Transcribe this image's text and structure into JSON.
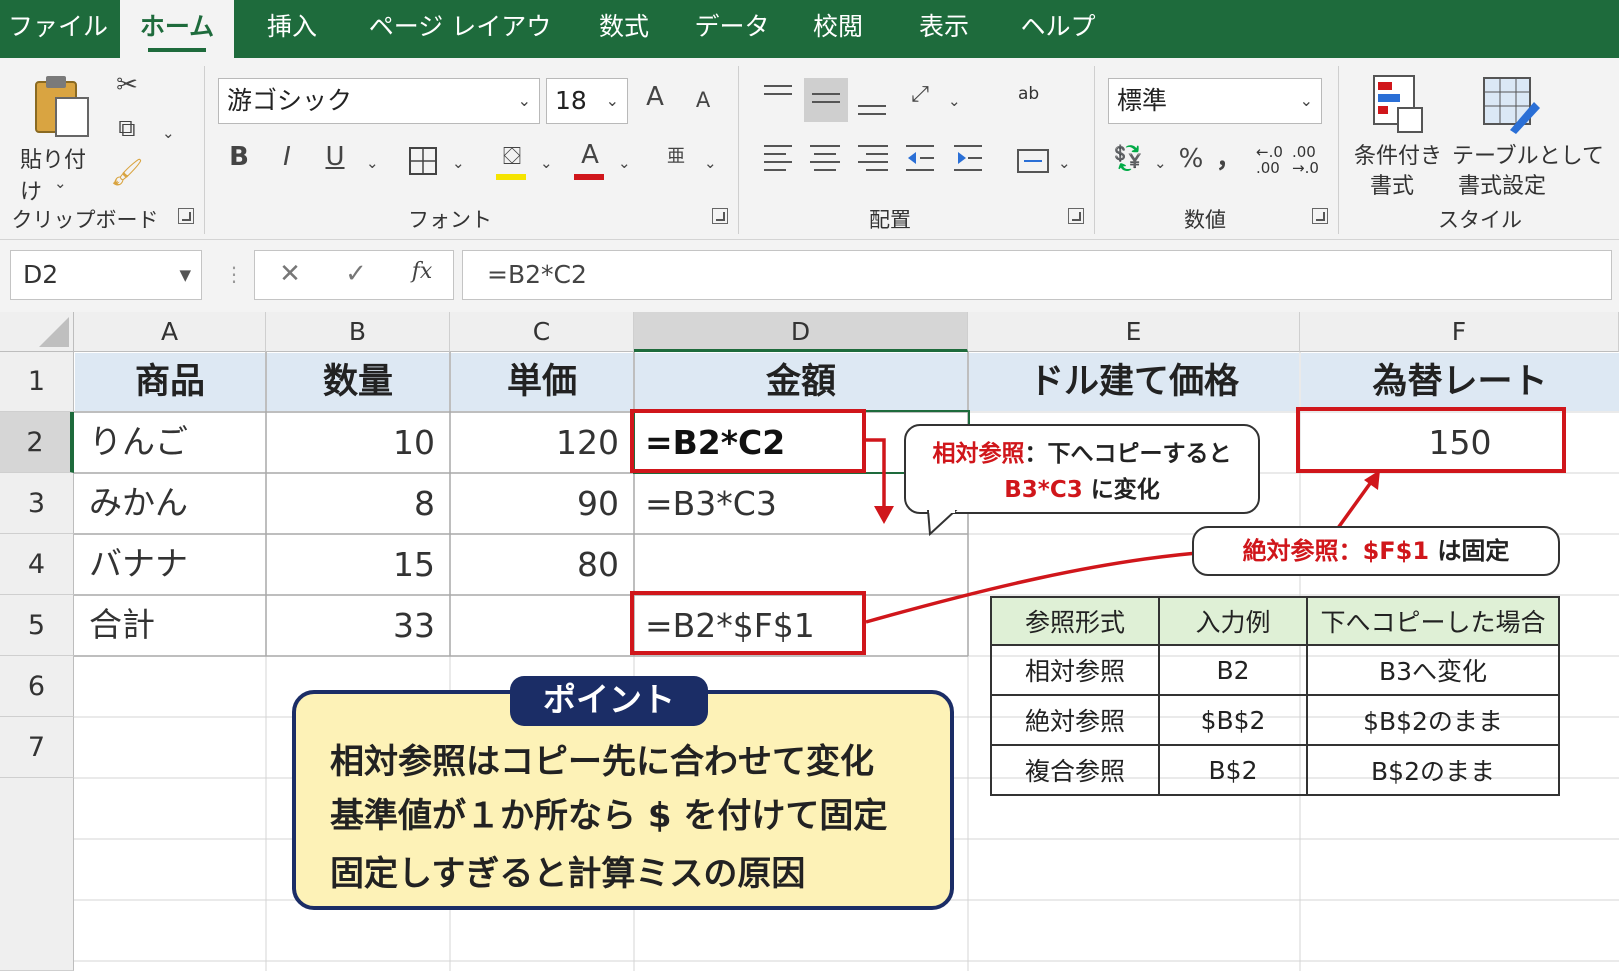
{
  "tabs": [
    "ファイル",
    "ホーム",
    "挿入",
    "ページ レイアウト",
    "数式",
    "データ",
    "校閲",
    "表示",
    "ヘルプ"
  ],
  "ribbon": {
    "clipboard": {
      "paste_label": "貼り付け",
      "group_label": "クリップボード"
    },
    "font": {
      "font_name": "游ゴシック",
      "font_size": "18",
      "bold": "B",
      "italic": "I",
      "underline": "U",
      "grow": "A",
      "shrink": "A",
      "font_color_glyph": "A",
      "group_label": "フォント"
    },
    "alignment": {
      "group_label": "配置",
      "wrap_glyph": "ab"
    },
    "number": {
      "format": "標準",
      "percent": "%",
      "comma": "，",
      "group_label": "数値"
    },
    "styles": {
      "conditional_label": "条件付き",
      "conditional_label2": "書式",
      "table_label": "テーブルとして",
      "table_label2": "書式設定",
      "group_label": "スタイル"
    }
  },
  "formula_bar": {
    "name_box": "D2",
    "cancel": "✕",
    "enter": "✓",
    "fx": "fx",
    "formula": "=B2*C2"
  },
  "columns": [
    "A",
    "B",
    "C",
    "D",
    "E",
    "F"
  ],
  "rows": [
    "1",
    "2",
    "3",
    "4",
    "5",
    "6",
    "7"
  ],
  "sheet": {
    "header": [
      "商品",
      "数量",
      "単価",
      "金額",
      "ドル建て価格",
      "為替レート"
    ],
    "r2": {
      "a": "りんご",
      "b": "10",
      "c": "120",
      "d": "=B2*C2",
      "f": "150"
    },
    "r3": {
      "a": "みかん",
      "b": "8",
      "c": "90",
      "d": "=B3*C3"
    },
    "r4": {
      "a": "バナナ",
      "b": "15",
      "c": "80"
    },
    "r5": {
      "a": "合計",
      "b": "33",
      "d": "=B2*$F$1"
    }
  },
  "callout_relative": {
    "term": "相対参照",
    "rest": "：下へコピーすると",
    "value": "B3*C3",
    "suffix": " に変化"
  },
  "callout_absolute": {
    "term": "絶対参照：",
    "value": "$F$1",
    "suffix": " は固定"
  },
  "ref_table": {
    "headers": [
      "参照形式",
      "入力例",
      "下へコピーした場合"
    ],
    "rows": [
      [
        "相対参照",
        "B2",
        "B3へ変化"
      ],
      [
        "絶対参照",
        "$B$2",
        "$B$2のまま"
      ],
      [
        "複合参照",
        "B$2",
        "B$2のまま"
      ]
    ]
  },
  "point": {
    "tag": "ポイント",
    "lines": [
      "相対参照はコピー先に合わせて変化",
      "基準値が１か所なら $ を付けて固定",
      "固定しすぎると計算ミスの原因"
    ]
  },
  "colors": {
    "excel_green": "#1e6b3c",
    "highlight_red": "#d0161b",
    "point_navy": "#1b2d66",
    "point_bg": "#fdf2b7",
    "header_blue": "#dde8f3",
    "table_head_green": "#dff0d6"
  }
}
